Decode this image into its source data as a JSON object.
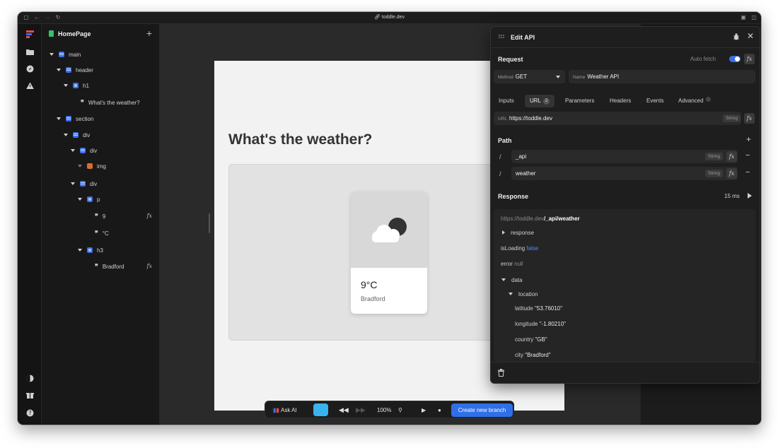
{
  "browser": {
    "url": "toddle.dev"
  },
  "tree": {
    "page_name": "HomePage",
    "nodes": [
      {
        "label": "main",
        "kind": "stack"
      },
      {
        "label": "header",
        "kind": "stack"
      },
      {
        "label": "h1",
        "kind": "box"
      },
      {
        "label": "What's the weather?",
        "kind": "text"
      },
      {
        "label": "section",
        "kind": "stack"
      },
      {
        "label": "div",
        "kind": "stack"
      },
      {
        "label": "div",
        "kind": "stack"
      },
      {
        "label": "img",
        "kind": "img"
      },
      {
        "label": "div",
        "kind": "stack"
      },
      {
        "label": "p",
        "kind": "box"
      },
      {
        "label": "9",
        "kind": "text",
        "formula": true
      },
      {
        "label": "°C",
        "kind": "text"
      },
      {
        "label": "h3",
        "kind": "box"
      },
      {
        "label": "Bradford",
        "kind": "text",
        "formula": true
      }
    ],
    "fx_label": "fx"
  },
  "canvas": {
    "title": "What's the weather?",
    "card_temp": "9°C",
    "card_city": "Bradford"
  },
  "panel": {
    "title": "Edit API",
    "request_label": "Request",
    "auto_fetch_label": "Auto fetch",
    "auto_fetch_on": true,
    "method_label": "Method",
    "method_value": "GET",
    "name_label": "Name",
    "name_value": "Weather API",
    "tabs": [
      {
        "label": "Inputs"
      },
      {
        "label": "URL",
        "badge": "2",
        "active": true
      },
      {
        "label": "Parameters"
      },
      {
        "label": "Headers"
      },
      {
        "label": "Events"
      },
      {
        "label": "Advanced",
        "badge": ""
      }
    ],
    "url_label": "URL",
    "url_value": "https://toddle.dev",
    "type_string": "String",
    "path_label": "Path",
    "path_separator": "/",
    "path_segments": [
      "_api",
      "weather"
    ],
    "response_label": "Response",
    "response_time": "15 ms",
    "response": {
      "url_base": "https://toddle.dev",
      "url_path": "/_api/weather",
      "response_key": "response",
      "isLoading_key": "isLoading",
      "isLoading_val": "false",
      "error_key": "error",
      "error_val": "null",
      "data_key": "data",
      "location_key": "location",
      "rows": [
        {
          "k": "latitude",
          "v": "\"53.76010\""
        },
        {
          "k": "longitude",
          "v": "\"-1.80210\""
        },
        {
          "k": "country",
          "v": "\"GB\""
        },
        {
          "k": "city",
          "v": "\"Bradford\""
        }
      ]
    }
  },
  "bottombar": {
    "ask_ai": "Ask AI",
    "zoom": "100%",
    "create_branch": "Create new branch"
  },
  "colors": {
    "accent": "#2f6fe8",
    "element_icon": "#3b6fe6",
    "img_icon": "#e06a2a",
    "page_icon": "#33c26b"
  }
}
